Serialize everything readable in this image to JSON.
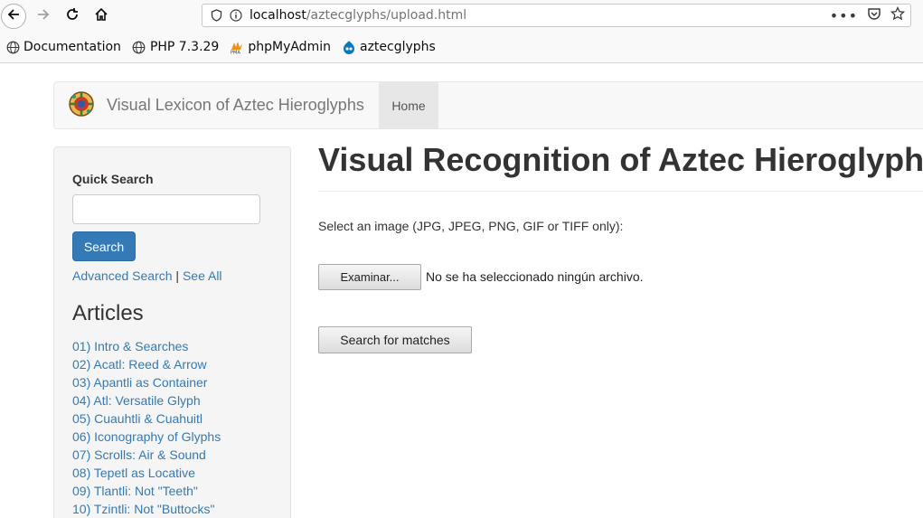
{
  "browser": {
    "url_host": "localhost",
    "url_path": "/aztecglyphs/upload.html",
    "nav": {
      "back_icon": "arrow-left-icon",
      "forward_icon": "arrow-right-icon",
      "reload_icon": "reload-icon",
      "home_icon": "home-icon"
    },
    "url_actions": [
      "more-icon",
      "pocket-icon",
      "star-icon"
    ]
  },
  "bookmarks": [
    {
      "label": "Documentation",
      "icon": "globe-icon"
    },
    {
      "label": "PHP 7.3.29",
      "icon": "globe-icon"
    },
    {
      "label": "phpMyAdmin",
      "icon": "pma-icon"
    },
    {
      "label": "aztecglyphs",
      "icon": "drupal-icon"
    }
  ],
  "navbar": {
    "brand_text": "Visual Lexicon of Aztec Hieroglyphs",
    "home_label": "Home"
  },
  "sidebar": {
    "quick_search_label": "Quick Search",
    "search_value": "",
    "search_button": "Search",
    "advanced_search": "Advanced Search",
    "separator": "|",
    "see_all": "See All",
    "articles_heading": "Articles",
    "articles": [
      "01) Intro & Searches",
      "02) Acatl: Reed & Arrow",
      "03) Apantli as Container",
      "04) Atl: Versatile Glyph",
      "05) Cuauhtli & Cuahuitl",
      "06) Iconography of Glyphs",
      "07) Scrolls: Air & Sound",
      "08) Tepetl as Locative",
      "09) Tlantli: Not \"Teeth\"",
      "10) Tzintli: Not \"Buttocks\""
    ]
  },
  "main": {
    "title": "Visual Recognition of Aztec Hieroglyphs",
    "select_instruction": "Select an image (JPG, JPEG, PNG, GIF or TIFF only):",
    "file_button": "Examinar...",
    "file_status": "No se ha seleccionado ningún archivo.",
    "submit_button": "Search for matches"
  },
  "colors": {
    "link": "#337ab7",
    "primary_button": "#337ab7",
    "text": "#333333"
  }
}
